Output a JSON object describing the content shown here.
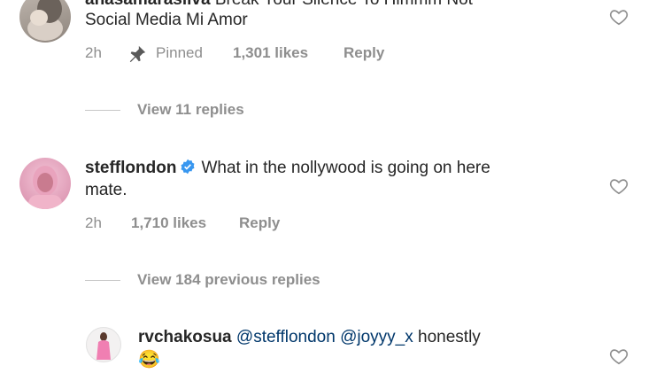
{
  "comments": [
    {
      "username_partial": "anasamarasilva",
      "text_line1_partial": "Break Your Silence To Himmm Not",
      "text_line2": "Social Media Mi Amor",
      "time": "2h",
      "pinned_label": "Pinned",
      "likes": "1,301 likes",
      "reply": "Reply",
      "view_replies": "View 11 replies"
    },
    {
      "username": "stefflondon",
      "verified": true,
      "text_line1": "What in the nollywood is going on here",
      "text_line2": "mate.",
      "time": "2h",
      "likes": "1,710 likes",
      "reply": "Reply",
      "view_replies": "View 184 previous replies"
    },
    {
      "username": "rvchakosua",
      "mention1": "@stefflondon",
      "mention2": "@joyyy_x",
      "text_after": "honestly",
      "emoji": "😂"
    }
  ],
  "icons": {
    "heart": "heart-outline-icon",
    "pin": "pin-icon",
    "verified": "verified-badge-icon",
    "emoji": "laughing-tears-emoji"
  },
  "colors": {
    "text": "#262626",
    "meta": "#8e8e8e",
    "verified": "#3897f0",
    "mention": "#00376b"
  }
}
